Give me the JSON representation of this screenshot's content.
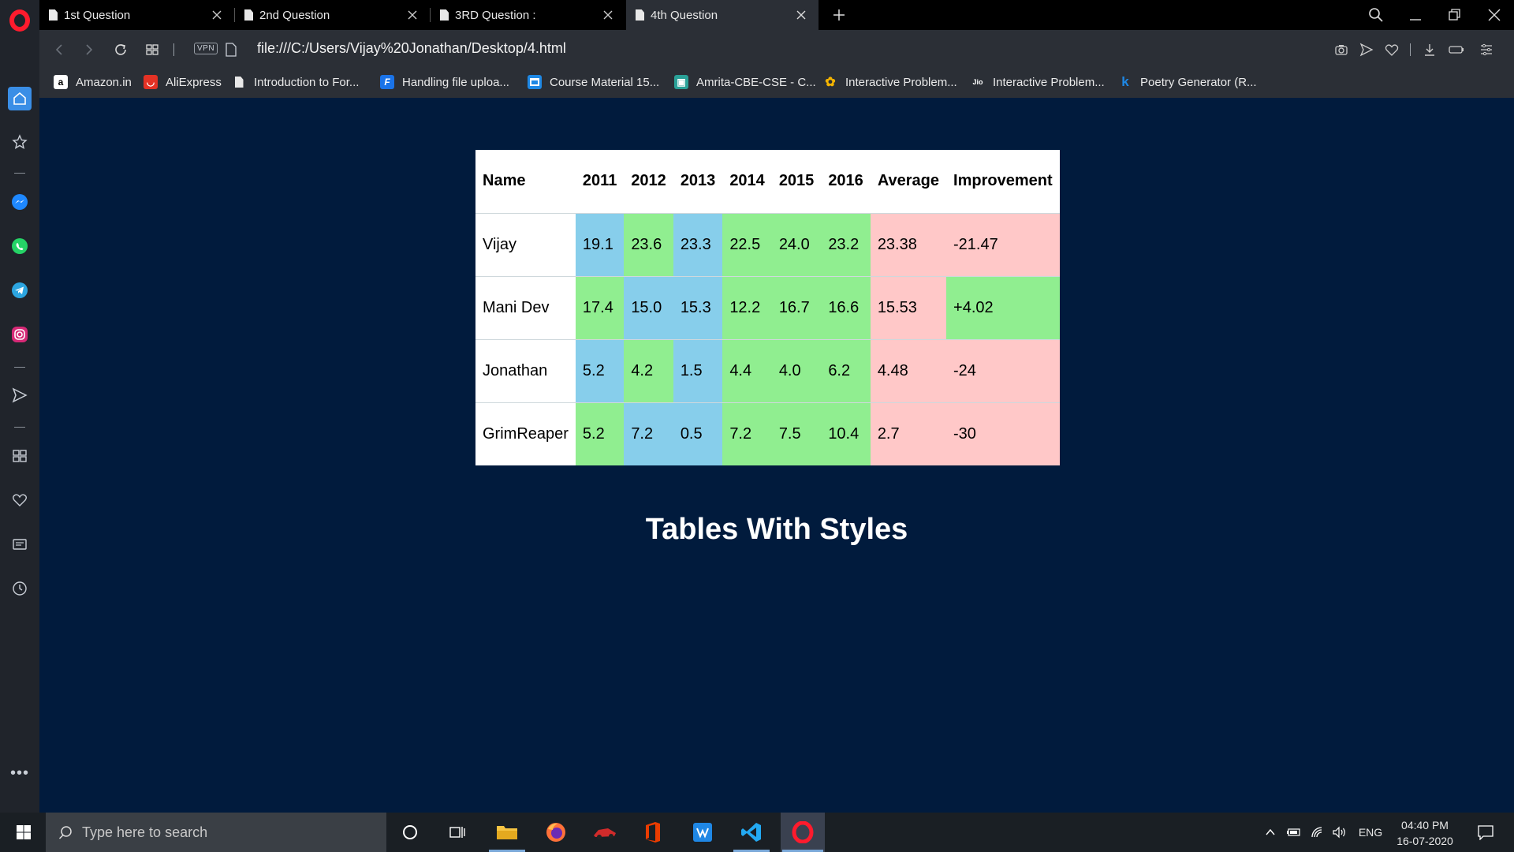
{
  "browser": {
    "tabs": [
      {
        "title": "1st Question",
        "active": false
      },
      {
        "title": "2nd Question",
        "active": false
      },
      {
        "title": "3RD Question :",
        "active": false
      },
      {
        "title": "4th Question",
        "active": true
      }
    ],
    "vpn_label": "VPN",
    "url": "file:///C:/Users/Vijay%20Jonathan/Desktop/4.html",
    "bookmarks": [
      {
        "label": "Amazon.in",
        "icon": "amazon-icon",
        "color": "#ffffff"
      },
      {
        "label": "AliExpress",
        "icon": "aliexpress-icon",
        "color": "#e43225"
      },
      {
        "label": "Introduction to For...",
        "icon": "document-icon",
        "color": "#e8e8e8"
      },
      {
        "label": "Handling file uploa...",
        "icon": "f-icon",
        "color": "#1a73e8"
      },
      {
        "label": "Course Material 15...",
        "icon": "course-icon",
        "color": "#1e88e5"
      },
      {
        "label": "Amrita-CBE-CSE - C...",
        "icon": "amrita-icon",
        "color": "#2aa198"
      },
      {
        "label": "Interactive Problem...",
        "icon": "plant-icon",
        "color": "#f4b400"
      },
      {
        "label": "Interactive Problem...",
        "icon": "jio-icon",
        "color": "#ffffff"
      },
      {
        "label": "Poetry Generator (R...",
        "icon": "k-icon",
        "color": "#1e88e5"
      }
    ]
  },
  "page": {
    "table": {
      "headers": [
        "Name",
        "2011",
        "2012",
        "2013",
        "2014",
        "2015",
        "2016",
        "Average",
        "Improvement"
      ],
      "rows": [
        {
          "cells": [
            "Vijay",
            "19.1",
            "23.6",
            "23.3",
            "22.5",
            "24.0",
            "23.2",
            "23.38",
            "-21.47"
          ],
          "colors": [
            "white",
            "blue",
            "green",
            "blue",
            "green",
            "green",
            "green",
            "pink",
            "pink"
          ]
        },
        {
          "cells": [
            "Mani Dev",
            "17.4",
            "15.0",
            "15.3",
            "12.2",
            "16.7",
            "16.6",
            "15.53",
            "+4.02"
          ],
          "colors": [
            "white",
            "green",
            "blue",
            "blue",
            "green",
            "green",
            "green",
            "pink",
            "green"
          ]
        },
        {
          "cells": [
            "Jonathan",
            "5.2",
            "4.2",
            "1.5",
            "4.4",
            "4.0",
            "6.2",
            "4.48",
            "-24"
          ],
          "colors": [
            "white",
            "blue",
            "green",
            "blue",
            "green",
            "green",
            "green",
            "pink",
            "pink"
          ]
        },
        {
          "cells": [
            "GrimReaper",
            "5.2",
            "7.2",
            "0.5",
            "7.2",
            "7.5",
            "10.4",
            "2.7",
            "-30"
          ],
          "colors": [
            "white",
            "green",
            "blue",
            "blue",
            "green",
            "green",
            "green",
            "pink",
            "pink"
          ]
        }
      ]
    },
    "heading": "Tables With Styles"
  },
  "taskbar": {
    "search_placeholder": "Type here to search",
    "language": "ENG",
    "time": "04:40 PM",
    "date": "16-07-2020"
  },
  "colors": {
    "page_background": "#011b3d",
    "cell_blue": "#87ceeb",
    "cell_green": "#90ee90",
    "cell_pink": "#ffc8c8",
    "opera_red": "#ff1b2d"
  }
}
